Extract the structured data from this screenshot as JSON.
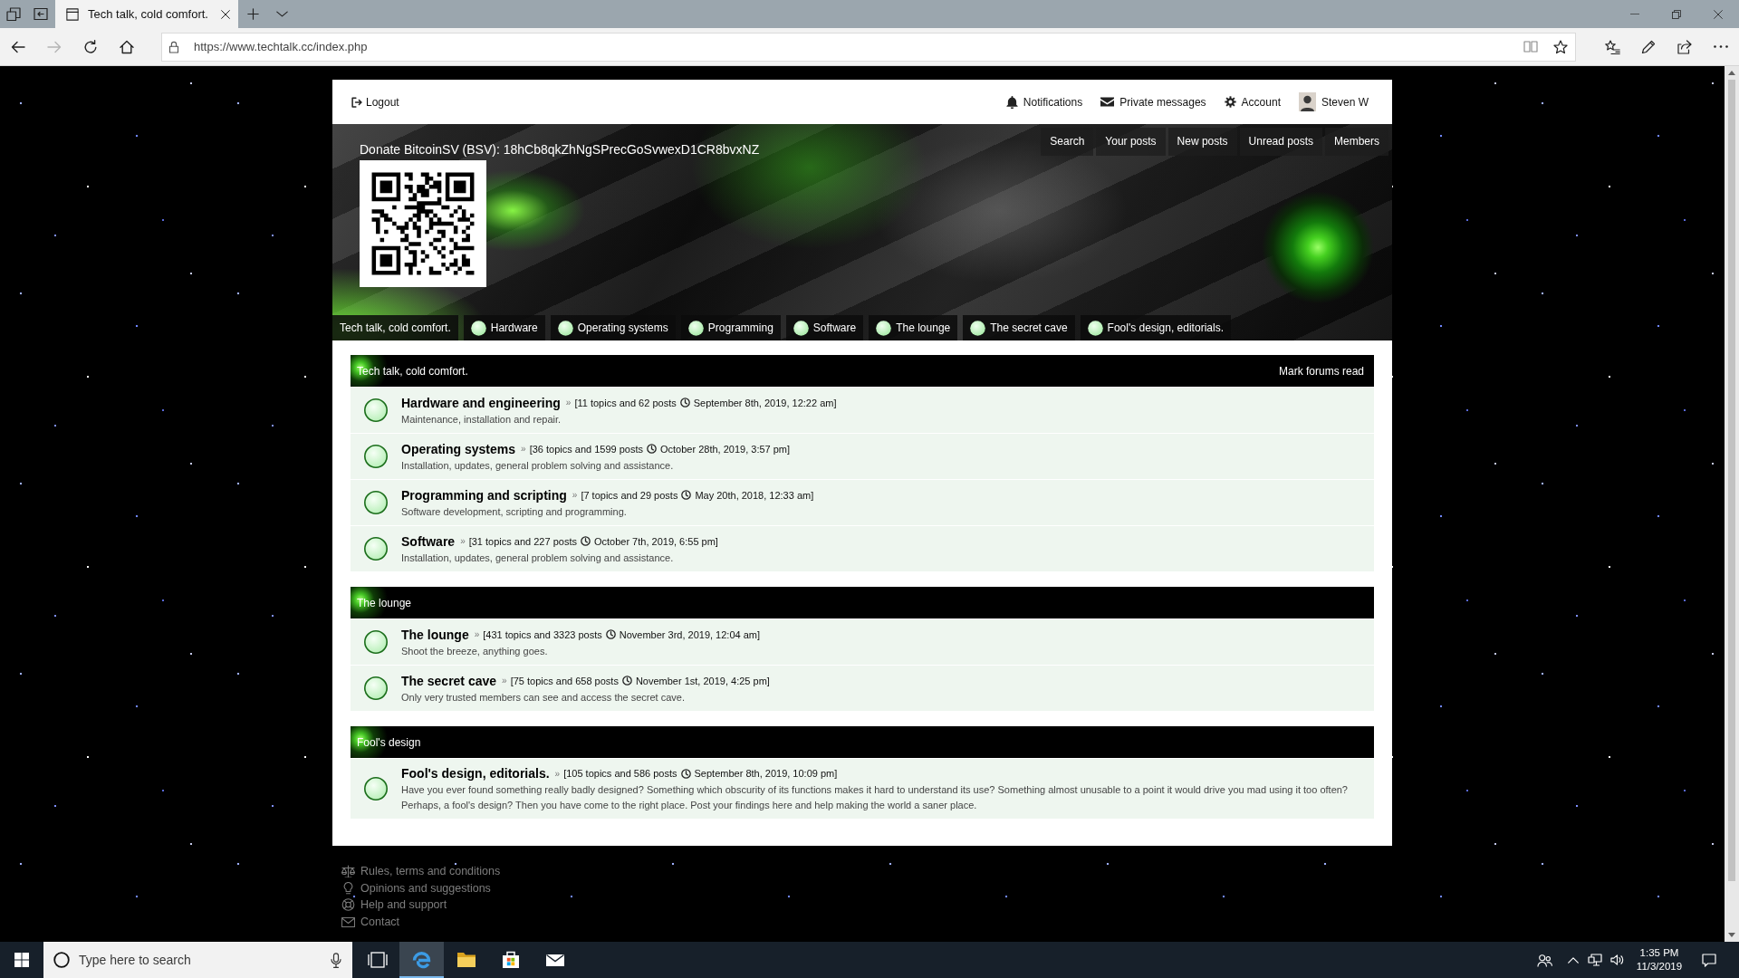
{
  "browser": {
    "tab": {
      "title": "Tech talk, cold comfort."
    },
    "nav": [
      {
        "kind": "back",
        "disabled": false
      },
      {
        "kind": "forward",
        "disabled": true
      },
      {
        "kind": "refresh",
        "disabled": false
      },
      {
        "kind": "home",
        "disabled": false
      }
    ],
    "url": "https://www.techtalk.cc/index.php"
  },
  "top_bar": {
    "logout": "Logout",
    "links": [
      {
        "kind": "bell",
        "label": "Notifications"
      },
      {
        "kind": "envelope",
        "label": "Private messages"
      },
      {
        "kind": "gear",
        "label": "Account"
      },
      {
        "kind": "avatar",
        "label": "Steven W"
      }
    ]
  },
  "banner": {
    "donate": "Donate BitcoinSV (BSV): 18hCb8qkZhNgSPrecGoSvwexD1CR8bvxNZ",
    "quick_links": [
      "Search",
      "Your posts",
      "New posts",
      "Unread posts",
      "Members"
    ],
    "home": "Tech talk, cold comfort.",
    "forum_links": [
      "Hardware",
      "Operating systems",
      "Programming",
      "Software",
      "The lounge",
      "The secret cave",
      "Fool's design, editorials."
    ]
  },
  "categories": [
    {
      "title": "Tech talk, cold comfort.",
      "action": "Mark forums read",
      "forums": [
        {
          "name": "Hardware and engineering",
          "separator": "»",
          "stats": "[11 topics and 62 posts",
          "last_post": "September 8th, 2019, 12:22 am]",
          "description": "Maintenance, installation and repair."
        },
        {
          "name": "Operating systems",
          "separator": "»",
          "stats": "[36 topics and 1599 posts",
          "last_post": "October 28th, 2019, 3:57 pm]",
          "description": "Installation, updates, general problem solving and assistance."
        },
        {
          "name": "Programming and scripting",
          "separator": "»",
          "stats": "[7 topics and 29 posts",
          "last_post": "May 20th, 2018, 12:33 am]",
          "description": "Software development, scripting and programming."
        },
        {
          "name": "Software",
          "separator": "»",
          "stats": "[31 topics and 227 posts",
          "last_post": "October 7th, 2019, 6:55 pm]",
          "description": "Installation, updates, general problem solving and assistance."
        }
      ]
    },
    {
      "title": "The lounge",
      "forums": [
        {
          "name": "The lounge",
          "separator": "»",
          "stats": "[431 topics and 3323 posts",
          "last_post": "November 3rd, 2019, 12:04 am]",
          "description": "Shoot the breeze, anything goes."
        },
        {
          "name": "The secret cave",
          "separator": "»",
          "stats": "[75 topics and 658 posts",
          "last_post": "November 1st, 2019, 4:25 pm]",
          "description": "Only very trusted members can see and access the secret cave."
        }
      ]
    },
    {
      "title": "Fool's design",
      "forums": [
        {
          "name": "Fool's design, editorials.",
          "separator": "»",
          "stats": "[105 topics and 586 posts",
          "last_post": "September 8th, 2019, 10:09 pm]",
          "description": "Have you ever found something really badly designed? Something which obscurity of its functions makes it hard to understand its use? Something almost unusable to a point it would drive you mad using it too often? Perhaps, a fool's design? Then you have come to the right place. Post your findings here and help making the world a saner place."
        }
      ]
    }
  ],
  "footer_links": [
    {
      "kind": "scales",
      "label": "Rules, terms and conditions"
    },
    {
      "kind": "bulb",
      "label": "Opinions and suggestions"
    },
    {
      "kind": "lifebuoy",
      "label": "Help and support"
    },
    {
      "kind": "envelope",
      "label": "Contact"
    }
  ],
  "taskbar": {
    "search_placeholder": "Type here to search",
    "apps": [
      {
        "kind": "task-view",
        "selected": false
      },
      {
        "kind": "browser",
        "selected": true
      },
      {
        "kind": "folder",
        "selected": false
      },
      {
        "kind": "store",
        "selected": false
      },
      {
        "kind": "mail",
        "selected": false
      }
    ],
    "time": "1:35 PM",
    "date": "11/3/2019"
  }
}
